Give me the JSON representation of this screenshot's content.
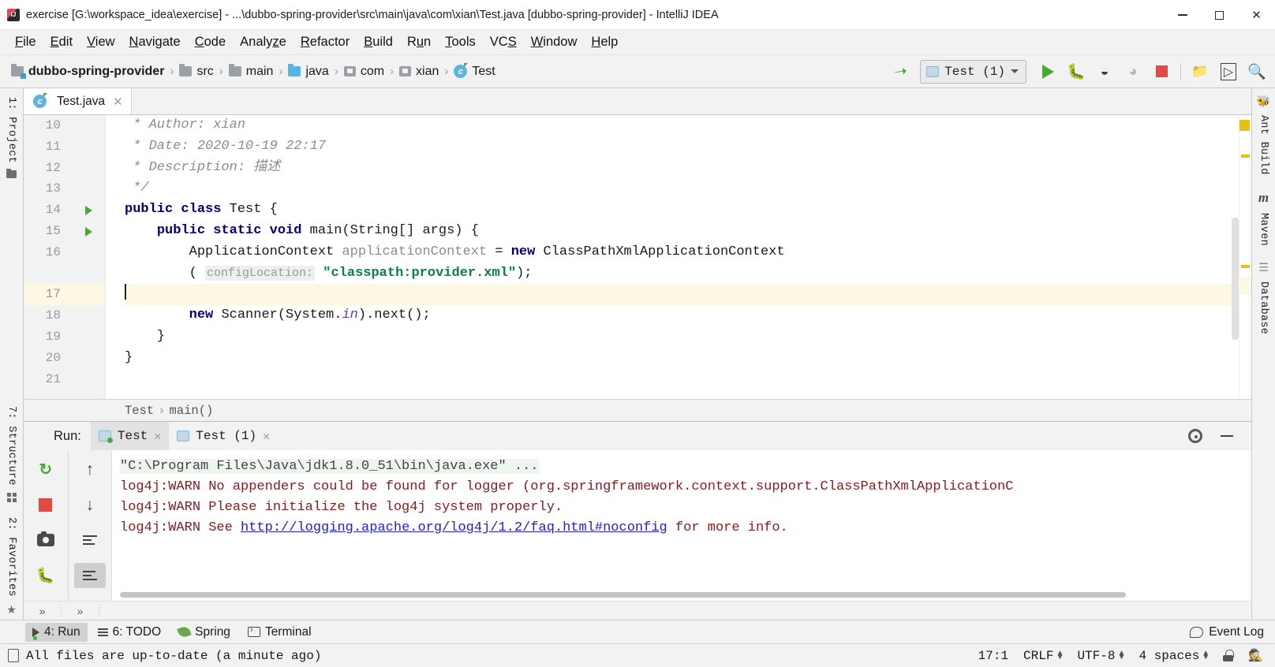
{
  "window": {
    "title": "exercise [G:\\workspace_idea\\exercise] - ...\\dubbo-spring-provider\\src\\main\\java\\com\\xian\\Test.java [dubbo-spring-provider] - IntelliJ IDEA",
    "minimize_label": "–",
    "maximize_label": "□",
    "close_label": "✕"
  },
  "menubar": {
    "items": [
      {
        "label": "File",
        "mnemonic": "F"
      },
      {
        "label": "Edit",
        "mnemonic": "E"
      },
      {
        "label": "View",
        "mnemonic": "V"
      },
      {
        "label": "Navigate",
        "mnemonic": "N"
      },
      {
        "label": "Code",
        "mnemonic": "C"
      },
      {
        "label": "Analyze",
        "mnemonic": "z"
      },
      {
        "label": "Refactor",
        "mnemonic": "R"
      },
      {
        "label": "Build",
        "mnemonic": "B"
      },
      {
        "label": "Run",
        "mnemonic": "u"
      },
      {
        "label": "Tools",
        "mnemonic": "T"
      },
      {
        "label": "VCS",
        "mnemonic": "S"
      },
      {
        "label": "Window",
        "mnemonic": "W"
      },
      {
        "label": "Help",
        "mnemonic": "H"
      }
    ]
  },
  "navbar": {
    "breadcrumbs": [
      {
        "label": "dubbo-spring-provider",
        "icon": "module-folder-icon"
      },
      {
        "label": "src",
        "icon": "folder-icon"
      },
      {
        "label": "main",
        "icon": "folder-icon"
      },
      {
        "label": "java",
        "icon": "source-folder-icon"
      },
      {
        "label": "com",
        "icon": "package-icon"
      },
      {
        "label": "xian",
        "icon": "package-icon"
      },
      {
        "label": "Test",
        "icon": "class-icon"
      }
    ],
    "separator": "›",
    "run_config": {
      "label": "Test (1)",
      "icon": "run-config-icon"
    },
    "buttons": [
      {
        "name": "build-button",
        "icon": "hammer-icon"
      },
      {
        "name": "run-button",
        "icon": "play-icon"
      },
      {
        "name": "debug-button",
        "icon": "bug-icon"
      },
      {
        "name": "run-coverage-button",
        "icon": "run-coverage-icon"
      },
      {
        "name": "profile-button",
        "icon": "profile-icon"
      },
      {
        "name": "stop-button",
        "icon": "stop-icon"
      },
      {
        "name": "update-project-button",
        "icon": "update-project-icon"
      },
      {
        "name": "open-preview-button",
        "icon": "preview-icon"
      },
      {
        "name": "search-everywhere-button",
        "icon": "search-icon"
      }
    ]
  },
  "left_strip": {
    "items": [
      {
        "label": "1: Project",
        "icon": "project-folder-icon"
      },
      {
        "label": "7: Structure",
        "icon": "structure-grid-icon"
      },
      {
        "label": "2: Favorites",
        "icon": "favorites-star-icon"
      }
    ]
  },
  "right_strip": {
    "items": [
      {
        "label": "Ant Build",
        "icon": "ant-icon"
      },
      {
        "label": "Maven",
        "icon": "maven-icon"
      },
      {
        "label": "Database",
        "icon": "database-icon"
      }
    ]
  },
  "editor": {
    "tabs": [
      {
        "label": "Test.java",
        "icon": "java-class-icon",
        "close": "✕",
        "active": true
      }
    ],
    "breadcrumb": {
      "class": "Test",
      "separator": "›",
      "method": "main()"
    },
    "lines": [
      {
        "num": "10",
        "indent": 1,
        "run_marker": false,
        "fold": "",
        "tokens": [
          {
            "t": "comment",
            "v": " * Author: xian"
          }
        ]
      },
      {
        "num": "11",
        "indent": 1,
        "run_marker": false,
        "fold": "",
        "tokens": [
          {
            "t": "comment",
            "v": " * Date: 2020-10-19 22:17"
          }
        ]
      },
      {
        "num": "12",
        "indent": 1,
        "run_marker": false,
        "fold": "",
        "tokens": [
          {
            "t": "comment",
            "v": " * Description: 描述"
          }
        ]
      },
      {
        "num": "13",
        "indent": 1,
        "run_marker": false,
        "fold": "end",
        "tokens": [
          {
            "t": "comment",
            "v": " */"
          }
        ]
      },
      {
        "num": "14",
        "indent": 0,
        "run_marker": true,
        "fold": "",
        "tokens": [
          {
            "t": "kw",
            "v": "public class "
          },
          {
            "t": "plain",
            "v": "Test {"
          }
        ]
      },
      {
        "num": "15",
        "indent": 0,
        "run_marker": true,
        "fold": "start",
        "tokens": [
          {
            "t": "plain",
            "v": "    "
          },
          {
            "t": "kw",
            "v": "public static void "
          },
          {
            "t": "plain",
            "v": "main(String[] args) {"
          }
        ]
      },
      {
        "num": "16",
        "indent": 0,
        "run_marker": false,
        "fold": "",
        "tokens": [
          {
            "t": "plain",
            "v": "        ApplicationContext "
          },
          {
            "t": "field",
            "v": "applicationContext "
          },
          {
            "t": "plain",
            "v": "= "
          },
          {
            "t": "kw",
            "v": "new "
          },
          {
            "t": "plain",
            "v": "ClassPathXmlApplicationContext"
          }
        ]
      },
      {
        "num": "",
        "indent": 0,
        "run_marker": false,
        "fold": "",
        "tokens": [
          {
            "t": "plain",
            "v": "        ( "
          },
          {
            "t": "hint",
            "v": "configLocation:"
          },
          {
            "t": "plain",
            "v": " "
          },
          {
            "t": "str",
            "v": "\"classpath:provider.xml\""
          },
          {
            "t": "plain",
            "v": ");"
          }
        ]
      },
      {
        "num": "17",
        "indent": 0,
        "run_marker": false,
        "fold": "",
        "highlight": true,
        "caret": true,
        "tokens": []
      },
      {
        "num": "18",
        "indent": 0,
        "run_marker": false,
        "fold": "",
        "tokens": [
          {
            "t": "plain",
            "v": "        "
          },
          {
            "t": "kw",
            "v": "new "
          },
          {
            "t": "plain",
            "v": "Scanner(System."
          },
          {
            "t": "static",
            "v": "in"
          },
          {
            "t": "plain",
            "v": ").next();"
          }
        ]
      },
      {
        "num": "19",
        "indent": 0,
        "run_marker": false,
        "fold": "end",
        "tokens": [
          {
            "t": "plain",
            "v": "    }"
          }
        ]
      },
      {
        "num": "20",
        "indent": 0,
        "run_marker": false,
        "fold": "",
        "tokens": [
          {
            "t": "plain",
            "v": "}"
          }
        ]
      },
      {
        "num": "21",
        "indent": 0,
        "run_marker": false,
        "fold": "",
        "tokens": []
      }
    ]
  },
  "run_window": {
    "label": "Run:",
    "tabs": [
      {
        "label": "Test",
        "close": "✕",
        "active": true
      },
      {
        "label": "Test (1)",
        "close": "✕",
        "active": false
      }
    ],
    "settings_icon": "gear-icon",
    "hide_icon": "minimize-icon",
    "toolbar_left": [
      {
        "name": "rerun-button",
        "icon": "rerun-icon"
      },
      {
        "name": "stop-button",
        "icon": "stop-icon"
      },
      {
        "name": "dump-threads-button",
        "icon": "camera-icon"
      },
      {
        "name": "attach-debugger-button",
        "icon": "bug-attach-icon"
      }
    ],
    "toolbar_right": [
      {
        "name": "up-stacktrace-button",
        "icon": "arrow-up-icon"
      },
      {
        "name": "down-stacktrace-button",
        "icon": "arrow-down-icon"
      },
      {
        "name": "soft-wrap-button",
        "icon": "wrap-icon"
      },
      {
        "name": "scroll-to-end-button",
        "icon": "scroll-end-icon"
      }
    ],
    "console": [
      {
        "type": "cmd",
        "text": "\"C:\\Program Files\\Java\\jdk1.8.0_51\\bin\\java.exe\" ..."
      },
      {
        "type": "warn",
        "text": "log4j:WARN No appenders could be found for logger (org.springframework.context.support.ClassPathXmlApplicationC"
      },
      {
        "type": "warn",
        "text": "log4j:WARN Please initialize the log4j system properly."
      },
      {
        "type": "warn_link",
        "prefix": "log4j:WARN See ",
        "link": "http://logging.apache.org/log4j/1.2/faq.html#noconfig",
        "suffix": " for more info."
      }
    ]
  },
  "bottom_bar": {
    "items": [
      {
        "label": "4: Run",
        "mnemonic": "4",
        "icon": "run-icon",
        "active": true
      },
      {
        "label": "6: TODO",
        "mnemonic": "6",
        "icon": "todo-icon",
        "active": false
      },
      {
        "label": "Spring",
        "mnemonic": "",
        "icon": "spring-leaf-icon",
        "active": false
      },
      {
        "label": "Terminal",
        "mnemonic": "",
        "icon": "terminal-icon",
        "active": false
      }
    ],
    "event_log": {
      "label": "Event Log",
      "icon": "event-log-icon"
    },
    "more": "»"
  },
  "status_bar": {
    "message": "All files are up-to-date (a minute ago)",
    "doc_icon": "document-icon",
    "caret_position": "17:1",
    "line_separator": "CRLF",
    "encoding": "UTF-8",
    "indent": "4 spaces",
    "lock_icon": "unlock-icon",
    "inspection_icon": "hector-hat-icon"
  },
  "colors": {
    "accent_green": "#4aa836",
    "accent_red": "#e24a44",
    "string_green": "#088048",
    "keyword_navy": "#000080",
    "warn_red": "#8b1a1a",
    "link_blue": "#2121d6",
    "highlight_yellow": "#fdf8e3",
    "marker_yellow": "#e8c014"
  }
}
